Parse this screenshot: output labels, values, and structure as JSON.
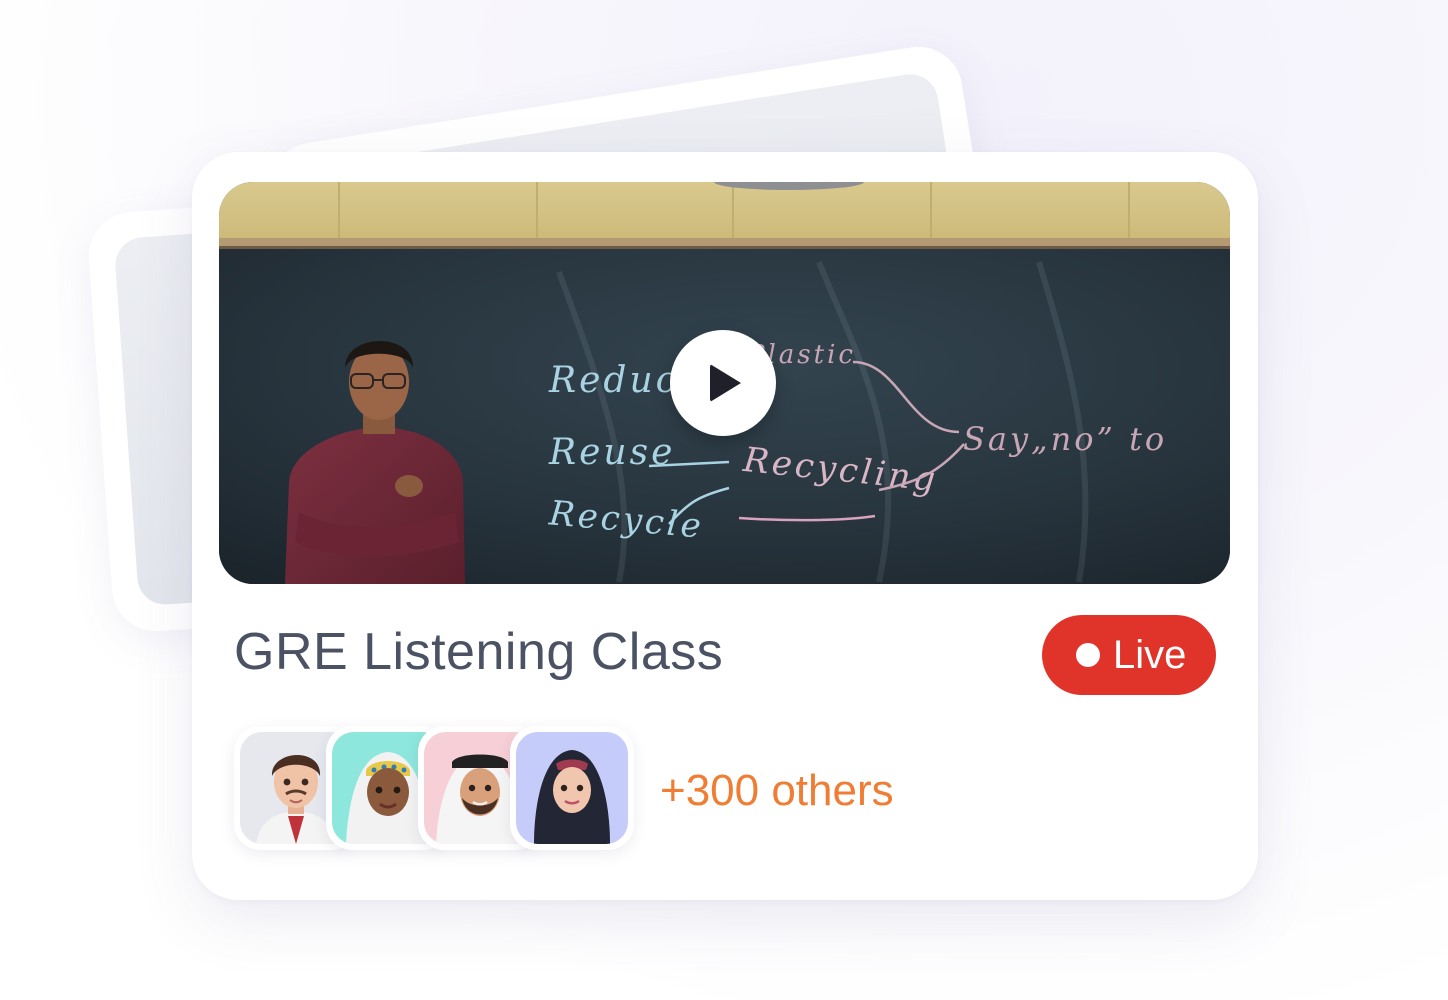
{
  "card": {
    "title": "GRE Listening Class",
    "live_label": "Live",
    "others_label": "+300 others"
  },
  "video": {
    "play_icon": "play-icon",
    "board_words": {
      "reduce": "Reduce",
      "reuse": "Reuse",
      "recycle": "Recycle",
      "recycling": "Recycling",
      "plastic": "Plastic",
      "say_no": "Say„no” to"
    }
  },
  "attendees": [
    {
      "name": "attendee-avatar-1",
      "bg": "#e6e8ee"
    },
    {
      "name": "attendee-avatar-2",
      "bg": "#8de7dc"
    },
    {
      "name": "attendee-avatar-3",
      "bg": "#f7cfd6"
    },
    {
      "name": "attendee-avatar-4",
      "bg": "#c6ccf9"
    }
  ],
  "colors": {
    "live": "#e0342a",
    "others": "#ef7d33",
    "title": "#4b5264"
  }
}
